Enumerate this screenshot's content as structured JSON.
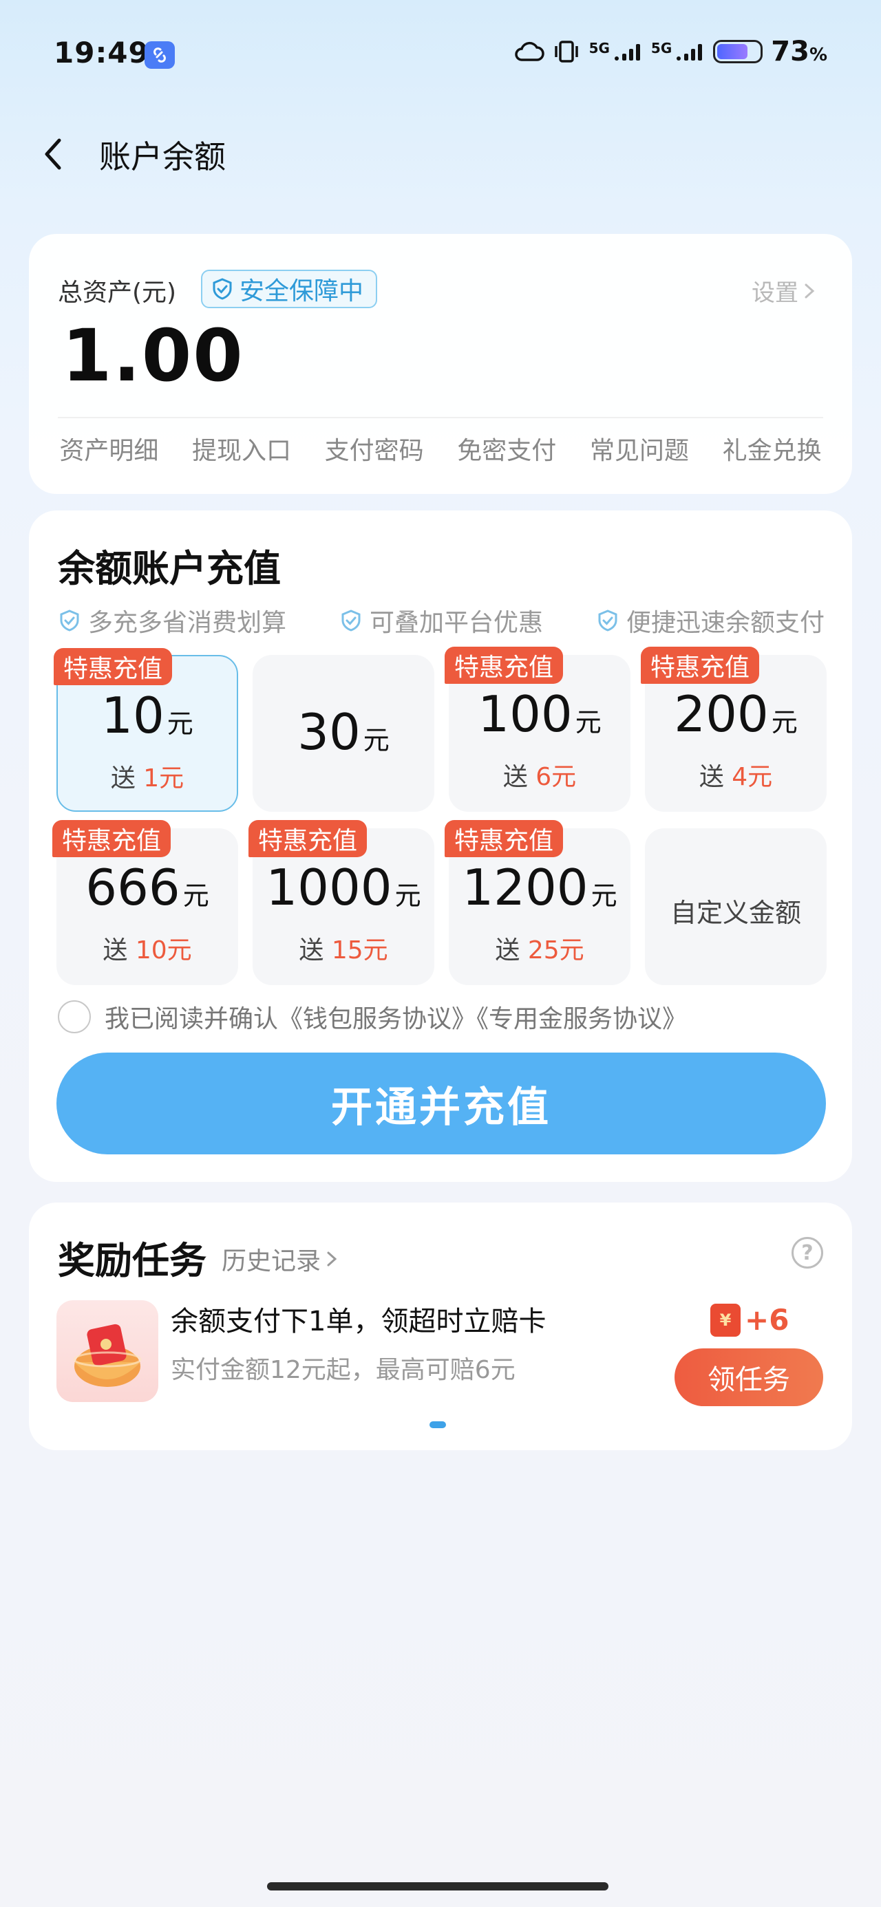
{
  "status_bar": {
    "time": "19:49",
    "network_1": "5G",
    "network_2": "5G",
    "battery_percent": "73",
    "battery_unit": "%",
    "icons": [
      "link-app-icon",
      "cloud-icon",
      "vibrate-icon",
      "signal-icon",
      "battery-icon"
    ]
  },
  "nav": {
    "title": "账户余额",
    "back_icon": "chevron-left-icon"
  },
  "assets": {
    "label": "总资产(元)",
    "safe_badge": "安全保障中",
    "settings": "设置",
    "balance": "1.00",
    "quick_links": [
      "资产明细",
      "提现入口",
      "支付密码",
      "免密支付",
      "常见问题",
      "礼金兑换"
    ]
  },
  "recharge": {
    "title": "余额账户充值",
    "benefits": [
      "多充多省消费划算",
      "可叠加平台优惠",
      "便捷迅速余额支付"
    ],
    "options": [
      {
        "tag": "特惠充值",
        "amount": "10",
        "unit": "元",
        "bonus_prefix": "送",
        "bonus": "1元",
        "selected": true
      },
      {
        "tag": "",
        "amount": "30",
        "unit": "元",
        "bonus_prefix": "",
        "bonus": "",
        "selected": false
      },
      {
        "tag": "特惠充值",
        "amount": "100",
        "unit": "元",
        "bonus_prefix": "送",
        "bonus": "6元",
        "selected": false
      },
      {
        "tag": "特惠充值",
        "amount": "200",
        "unit": "元",
        "bonus_prefix": "送",
        "bonus": "4元",
        "selected": false
      },
      {
        "tag": "特惠充值",
        "amount": "666",
        "unit": "元",
        "bonus_prefix": "送",
        "bonus": "10元",
        "selected": false
      },
      {
        "tag": "特惠充值",
        "amount": "1000",
        "unit": "元",
        "bonus_prefix": "送",
        "bonus": "15元",
        "selected": false
      },
      {
        "tag": "特惠充值",
        "amount": "1200",
        "unit": "元",
        "bonus_prefix": "送",
        "bonus": "25元",
        "selected": false
      }
    ],
    "custom_label": "自定义金额",
    "agreement": "我已阅读并确认《钱包服务协议》《专用金服务协议》",
    "cta": "开通并充值"
  },
  "rewards": {
    "title": "奖励任务",
    "history": "历史记录",
    "task": {
      "name": "余额支付下1单，领超时立赔卡",
      "desc": "实付金额12元起，最高可赔6元",
      "reward": "+6",
      "currency_symbol": "¥",
      "button": "领任务"
    }
  },
  "colors": {
    "accent_blue": "#55b2f4",
    "promo_red": "#ed5a3d",
    "safe_blue": "#2e9ad8"
  }
}
